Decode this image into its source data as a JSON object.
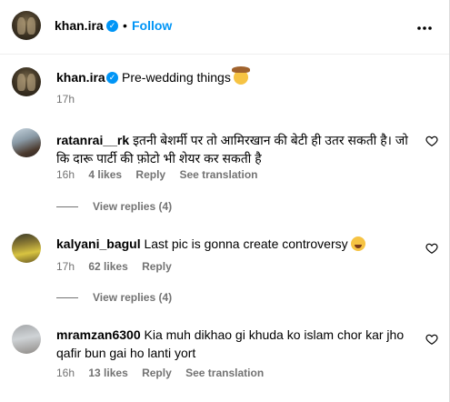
{
  "header": {
    "username": "khan.ira",
    "separator": "•",
    "follow_label": "Follow",
    "more_label": "•••"
  },
  "caption": {
    "username": "khan.ira",
    "text": "Pre-wedding things",
    "emoji": "cowboy-face-emoji",
    "time": "17h"
  },
  "comments": [
    {
      "username": "ratanrai__rk",
      "text": "इतनी बेशर्मी पर तो आमिरखान की बेटी ही उतर सकती है। जो कि दारू पार्टी की फ़ोटो भी शेयर कर सकती है",
      "time": "16h",
      "likes": "4 likes",
      "reply_label": "Reply",
      "translate_label": "See translation",
      "view_replies": "View replies (4)"
    },
    {
      "username": "kalyani_bagul",
      "text": "Last pic is gonna create controversy",
      "emoji": "laughing-face-emoji",
      "time": "17h",
      "likes": "62 likes",
      "reply_label": "Reply",
      "view_replies": "View replies (4)"
    },
    {
      "username": "mramzan6300",
      "text": "Kia muh dikhao gi khuda ko islam chor kar jho qafir bun gai ho lanti yort",
      "time": "16h",
      "likes": "13 likes",
      "reply_label": "Reply",
      "translate_label": "See translation"
    }
  ],
  "colors": {
    "link_blue": "#0095f6",
    "meta_gray": "#737373",
    "verified_blue": "#0095f6"
  },
  "icons": {
    "verified": "verified-badge-icon",
    "like": "heart-outline-icon",
    "more": "more-options-icon"
  }
}
